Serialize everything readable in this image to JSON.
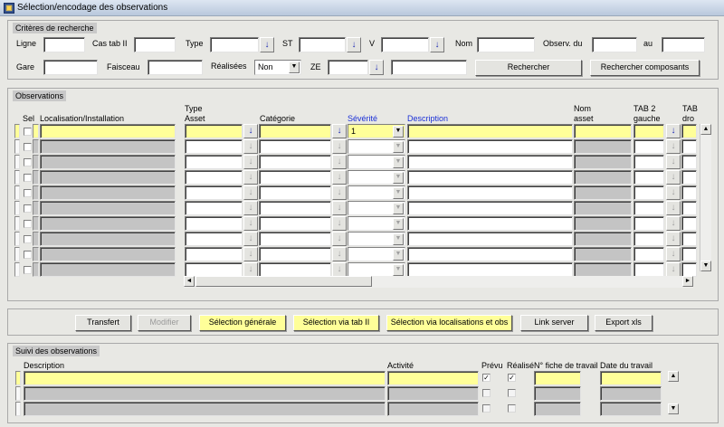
{
  "window": {
    "title": "Sélection/encodage des observations"
  },
  "criteria": {
    "panel_title": "Critères de recherche",
    "ligne_label": "Ligne",
    "cas_tab_label": "Cas tab II",
    "type_label": "Type",
    "st_label": "ST",
    "v_label": "V",
    "nom_label": "Nom",
    "observ_du_label": "Observ. du",
    "au_label": "au",
    "gare_label": "Gare",
    "faisceau_label": "Faisceau",
    "realisees_label": "Réalisées",
    "realisees_value": "Non",
    "ze_label": "ZE",
    "search_button": "Rechercher",
    "search_components_button": "Rechercher composants"
  },
  "observations": {
    "panel_title": "Observations",
    "columns": {
      "sel": "Sel",
      "localisation": "Localisation/Installation",
      "type_asset_1": "Type",
      "type_asset_2": "Asset",
      "categorie": "Catégorie",
      "severite": "Sévérité",
      "description": "Description",
      "nom_asset_1": "Nom",
      "nom_asset_2": "asset",
      "tab2_gauche_1": "TAB 2",
      "tab2_gauche_2": "gauche",
      "tab2_droite_1": "TAB",
      "tab2_droite_2": "dro"
    },
    "first_row_severity": "1"
  },
  "actions": {
    "transfert": "Transfert",
    "modifier": "Modifier",
    "selection_generale": "Sélection générale",
    "selection_tab": "Sélection via tab II",
    "selection_localisations": "Sélection via localisations et obs",
    "link_server": "Link server",
    "export_xls": "Export xls"
  },
  "suivi": {
    "panel_title": "Suivi des observations",
    "columns": {
      "description": "Description",
      "activite": "Activité",
      "prevu": "Prévu",
      "realise": "Réalisé",
      "fiche": "N° fiche de travail",
      "date": "Date du travail"
    },
    "first_row_prevu": "✓",
    "first_row_realise": "✓"
  },
  "icons": {
    "lov_arrow": "↓",
    "dropdown_arrow": "▼",
    "scroll_up": "▲",
    "scroll_down": "▼",
    "scroll_left": "◄",
    "scroll_right": "►"
  }
}
